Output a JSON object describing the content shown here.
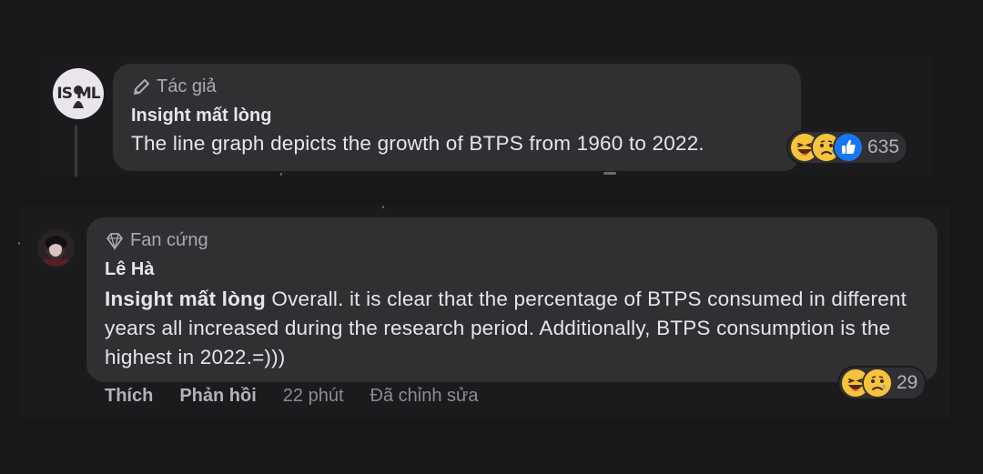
{
  "top_comment": {
    "badge_label": "Tác giả",
    "avatar_text": "IS ML",
    "author": "Insight mất lòng",
    "text": "The line graph depicts the growth of BTPS from 1960 to 2022.",
    "reactions": {
      "icons": [
        "laugh-icon",
        "sad-icon",
        "like-icon"
      ],
      "count": "635"
    }
  },
  "bottom_comment": {
    "badge_label": "Fan cứng",
    "author": "Lê Hà",
    "mention": "Insight mất lòng",
    "text": "Overall. it is clear that the percentage of BTPS consumed in different years all increased during the research period. Additionally, BTPS consumption is the highest in 2022.=)))",
    "reactions": {
      "icons": [
        "laugh-icon",
        "sad-icon"
      ],
      "count": "29"
    },
    "actions": {
      "like": "Thích",
      "reply": "Phản hồi",
      "time": "22 phút",
      "edited": "Đã chỉnh sửa"
    }
  },
  "colors": {
    "background": "#18181a",
    "bubble": "#303032",
    "text": "#e4e6eb",
    "muted": "#b0b3b8",
    "like_blue": "#1877f2",
    "emoji_yellow": "#f7c33b"
  }
}
